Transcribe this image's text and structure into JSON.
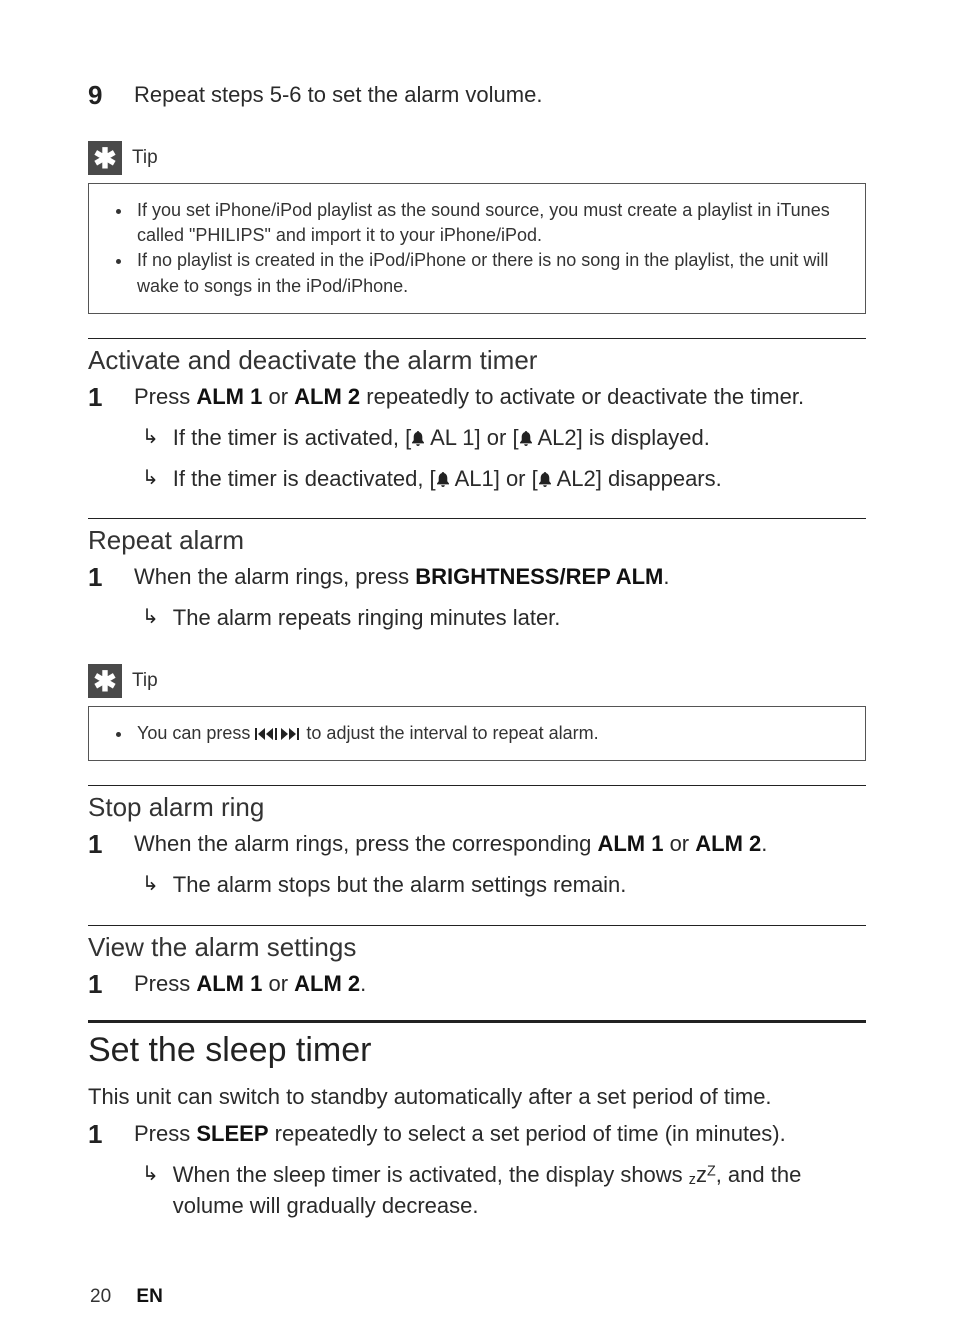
{
  "step9": {
    "num": "9",
    "text": "Repeat steps 5-6 to set the alarm volume."
  },
  "tip1": {
    "label": "Tip",
    "items": [
      "If you set iPhone/iPod playlist as the sound source, you must create a playlist in iTunes called \"PHILIPS\" and import it to your iPhone/iPod.",
      "If no playlist is created in the iPod/iPhone or there is no song in the playlist, the unit will wake to songs in the iPod/iPhone."
    ]
  },
  "sec_activate": {
    "title": "Activate and deactivate the alarm timer",
    "step_num": "1",
    "step_pre": "Press ",
    "alm1": "ALM 1",
    "or": " or ",
    "alm2": "ALM 2",
    "step_post": " repeatedly to activate or deactivate the timer.",
    "r1a": "If the timer is activated, [",
    "r1b": "  AL 1] or [",
    "r1c": "  AL2] is displayed.",
    "r2a": "If the timer is deactivated, [",
    "r2b": "  AL1] or [",
    "r2c": "  AL2] disappears."
  },
  "sec_repeat": {
    "title": "Repeat alarm",
    "step_num": "1",
    "step_pre": "When the alarm rings, press ",
    "btn": "BRIGHTNESS/REP ALM",
    "step_post": ".",
    "result": "The alarm repeats ringing minutes later."
  },
  "tip2": {
    "label": "Tip",
    "pre": "You can press ",
    "post": " to adjust the interval to repeat alarm."
  },
  "sec_stop": {
    "title": "Stop alarm ring",
    "step_num": "1",
    "step_pre": "When the alarm rings, press the corresponding ",
    "alm1": "ALM 1",
    "or": " or ",
    "alm2": "ALM 2",
    "step_post": ".",
    "result": "The alarm stops but the alarm settings remain."
  },
  "sec_view": {
    "title": "View the alarm settings",
    "step_num": "1",
    "step_pre": "Press ",
    "alm1": "ALM 1",
    "or": " or ",
    "alm2": "ALM 2",
    "step_post": "."
  },
  "sec_sleep": {
    "title": "Set the sleep timer",
    "intro": "This unit can switch to standby automatically after a set period of time.",
    "step_num": "1",
    "step_pre": "Press ",
    "btn": "SLEEP",
    "step_post": " repeatedly to select a set period of time (in minutes).",
    "result_a": "When the sleep timer is activated, the display shows ",
    "result_b": ", and the volume will gradually decrease."
  },
  "footer": {
    "page": "20",
    "lang": "EN"
  },
  "icons": {
    "asterisk": "✱",
    "arrow": "↳"
  }
}
